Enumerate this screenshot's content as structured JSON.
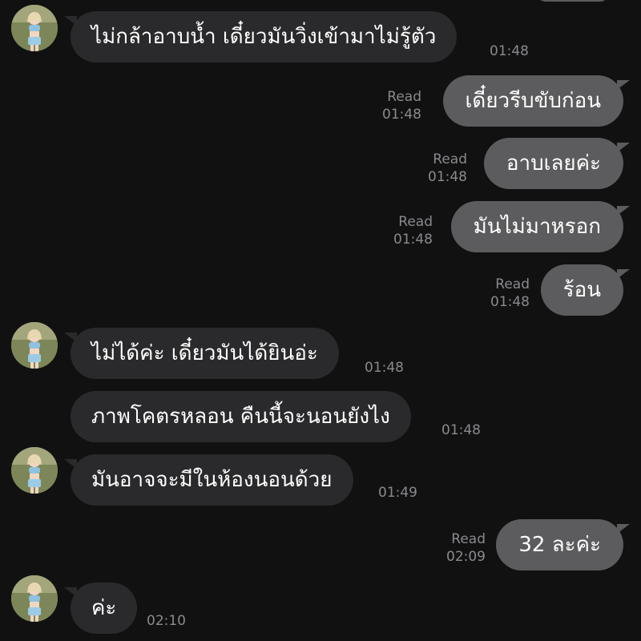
{
  "chat": {
    "messages": [
      {
        "id": "m1",
        "side": "in",
        "text": "ไม่กล้าอาบน้ำ เดี๋ยวมันวิ่งเข้ามาไม่รู้ตัว",
        "time": "01:48"
      },
      {
        "id": "m2",
        "side": "out",
        "text": "เดี๋ยวรีบขับก่อน",
        "read": "Read",
        "time": "01:48"
      },
      {
        "id": "m3",
        "side": "out",
        "text": "อาบเลยค่ะ",
        "read": "Read",
        "time": "01:48"
      },
      {
        "id": "m4",
        "side": "out",
        "text": "มันไม่มาหรอก",
        "read": "Read",
        "time": "01:48"
      },
      {
        "id": "m5",
        "side": "out",
        "text": "ร้อน",
        "read": "Read",
        "time": "01:48"
      },
      {
        "id": "m6",
        "side": "in",
        "text": "ไม่ได้ค่ะ เดี๋ยวมันได้ยินอ่ะ",
        "time": "01:48"
      },
      {
        "id": "m7",
        "side": "in",
        "text": "ภาพโคตรหลอน คืนนี้จะนอนยังไง",
        "time": "01:48"
      },
      {
        "id": "m8",
        "side": "in",
        "text": "มันอาจจะมีในห้องนอนด้วย",
        "time": "01:49"
      },
      {
        "id": "m9",
        "side": "out",
        "text": "32 ละค่ะ",
        "read": "Read",
        "time": "02:09"
      },
      {
        "id": "m10",
        "side": "in",
        "text": "ค่ะ",
        "time": "02:10"
      }
    ]
  },
  "colors": {
    "background": "#111112",
    "incoming_bubble": "#2a2a2c",
    "outgoing_bubble": "#5c5c5e",
    "meta_text": "#8a8a8e"
  },
  "icons": {
    "avatar": "contact-avatar-photo"
  }
}
